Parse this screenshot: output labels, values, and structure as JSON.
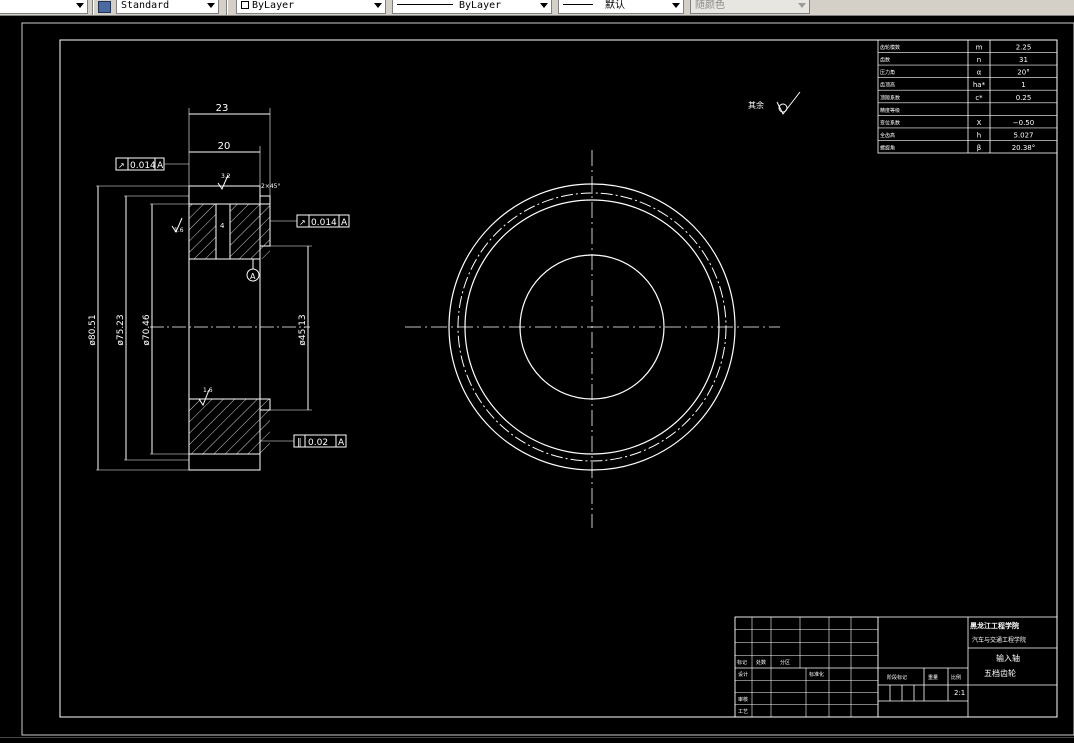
{
  "toolbar": {
    "textstyle_icon": "text-style-icon",
    "textstyle_value": "Standard",
    "color_value": "ByLayer",
    "linetype_value": "ByLayer",
    "lineweight_value": "默认",
    "plotstyle_value": "随颜色"
  },
  "drawing": {
    "dims": {
      "width_total": "23",
      "width_inner": "20",
      "dia_outer": "ø80.51",
      "dia_pitch": "ø75.23",
      "dia_root": "ø70.46",
      "dia_bore": "ø45.13",
      "chamfer": "2×45°",
      "keyway": "4",
      "rough_left": "1.6",
      "rough_bottom": "1.6",
      "rough_top": "3.2"
    },
    "tolerances": {
      "runout_left": "0.014",
      "runout_right": "0.014",
      "parallel": "0.02",
      "datum": "A"
    },
    "other_surfaces": "其余",
    "datum_label": "A"
  },
  "params": {
    "rows": [
      {
        "name": "齿轮模数",
        "sym": "m",
        "val": "2.25"
      },
      {
        "name": "齿数",
        "sym": "n",
        "val": "31"
      },
      {
        "name": "压力角",
        "sym": "α",
        "val": "20°"
      },
      {
        "name": "齿顶高",
        "sym": "ha*",
        "val": "1"
      },
      {
        "name": "顶隙系数",
        "sym": "c*",
        "val": "0.25"
      },
      {
        "name": "精度等级",
        "sym": "",
        "val": ""
      },
      {
        "name": "变位系数",
        "sym": "X",
        "val": "−0.50"
      },
      {
        "name": "全齿高",
        "sym": "h",
        "val": "5.027"
      },
      {
        "name": "螺旋角",
        "sym": "β",
        "val": "20.38°"
      }
    ]
  },
  "titleblock": {
    "school": "黑龙江工程学院",
    "dept": "汽车与交通工程学院",
    "part_name": "输入轴",
    "part_name2": "五档齿轮",
    "scale_label": "比例",
    "scale_value": "2:1",
    "weight_label": "重量",
    "stage_label": "阶段标记",
    "design": "设计",
    "review": "审核",
    "process": "工艺",
    "standard": "标准化",
    "mark": "标记",
    "count": "处数",
    "zone": "分区"
  }
}
